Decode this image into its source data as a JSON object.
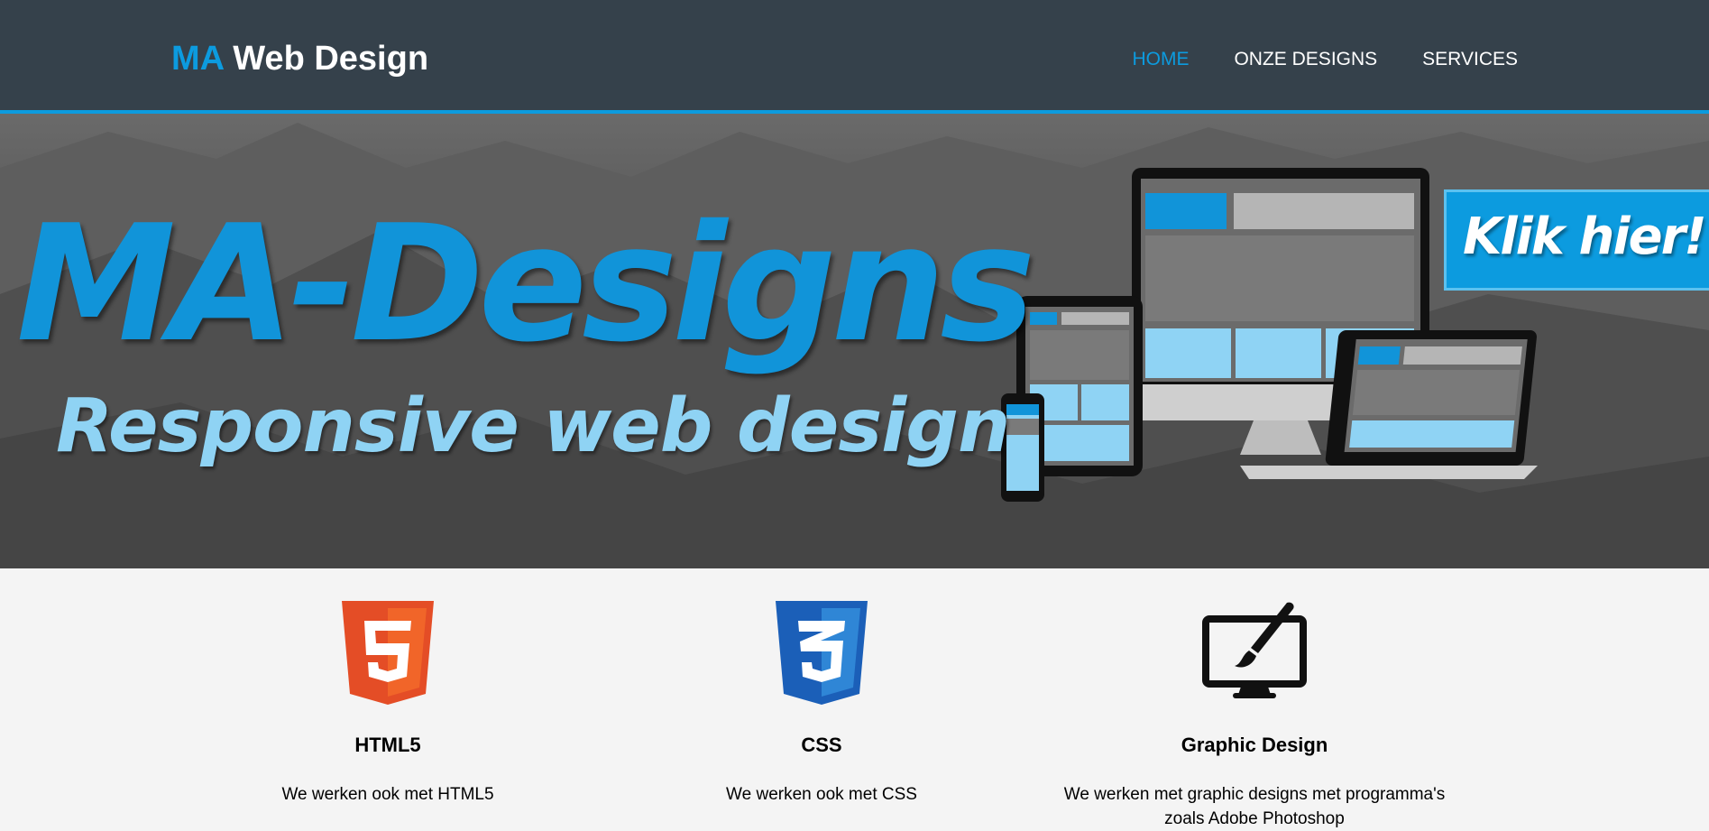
{
  "header": {
    "logo_accent": "MA",
    "logo_text": "Web Design",
    "nav": [
      {
        "label": "HOME",
        "active": true
      },
      {
        "label": "ONZE DESIGNS",
        "active": false
      },
      {
        "label": "SERVICES",
        "active": false
      }
    ]
  },
  "hero": {
    "title": "MA-Designs",
    "subtitle": "Responsive web design",
    "cta_label": "Klik hier!"
  },
  "services": [
    {
      "icon": "html5-icon",
      "title": "HTML5",
      "text": "We werken ook met HTML5"
    },
    {
      "icon": "css3-icon",
      "title": "CSS",
      "text": "We werken ook met CSS"
    },
    {
      "icon": "graphic-design-icon",
      "title": "Graphic Design",
      "text": "We werken met graphic designs met programma's zoals Adobe Photoshop"
    }
  ],
  "colors": {
    "accent": "#0c9bdf",
    "header_bg": "#35414b",
    "page_bg": "#f4f4f4",
    "html5": "#e44d26",
    "css3": "#2965f1"
  }
}
